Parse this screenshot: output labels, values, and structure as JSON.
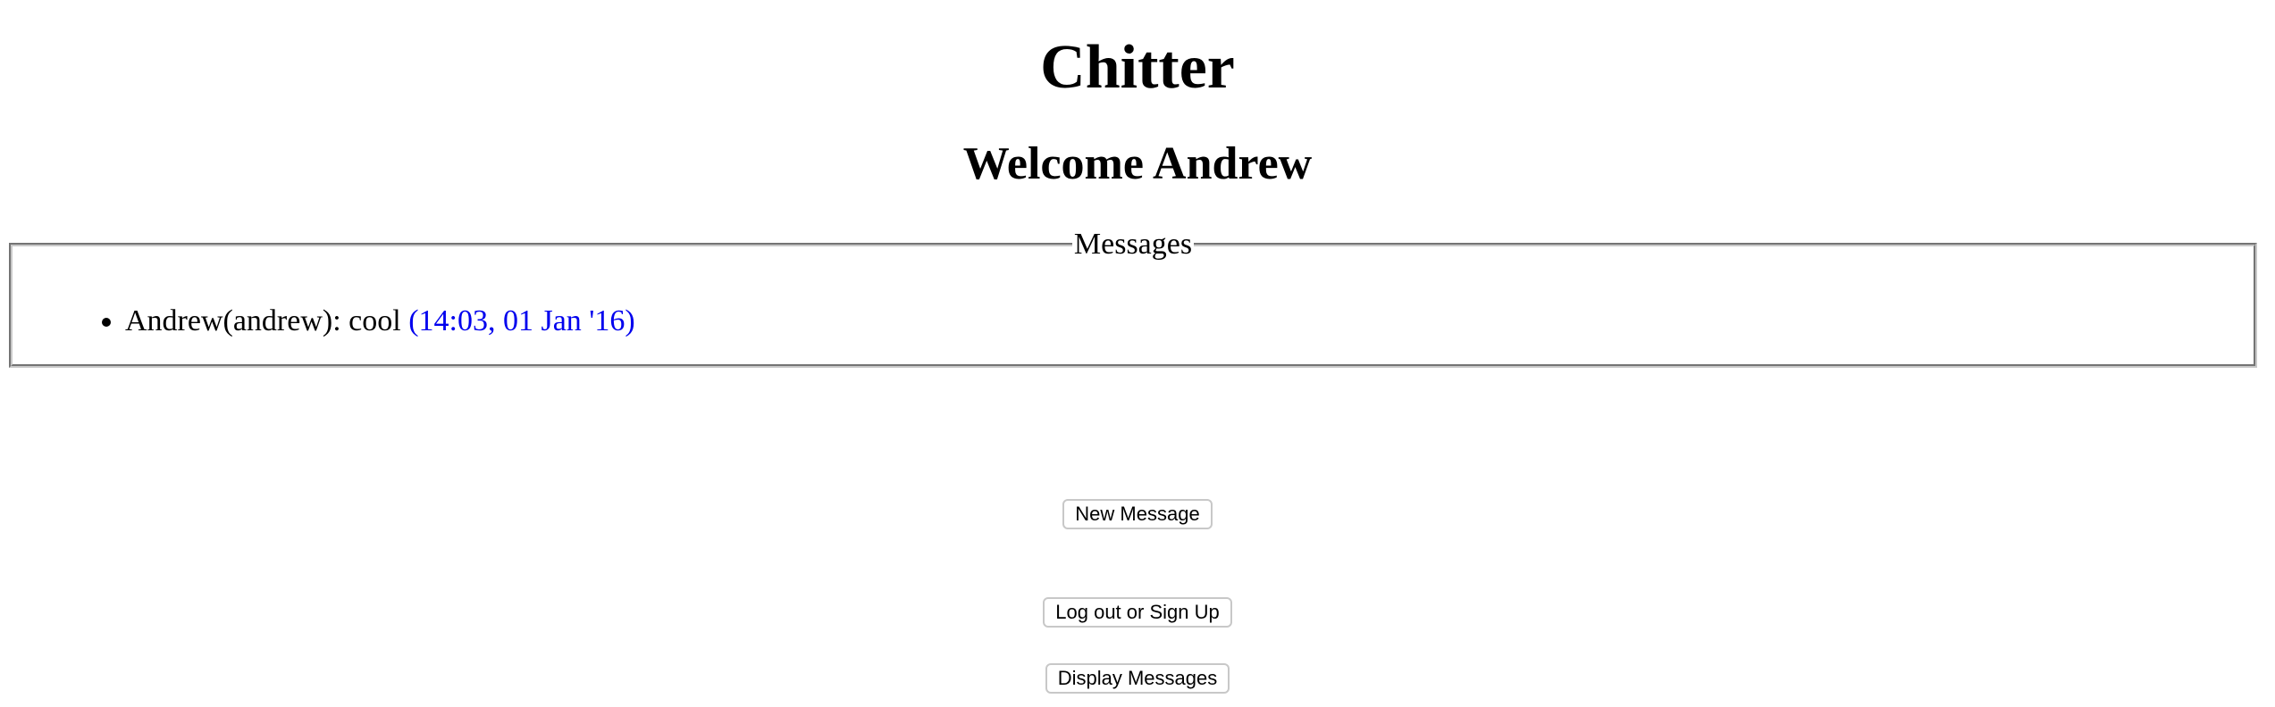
{
  "header": {
    "title": "Chitter",
    "welcome": "Welcome Andrew"
  },
  "messages": {
    "legend": "Messages",
    "items": [
      {
        "text": "Andrew(andrew): cool",
        "time": "(14:03, 01 Jan '16)"
      }
    ]
  },
  "actions": {
    "new_message": "New Message",
    "logout_signup": "Log out or Sign Up",
    "display_messages": "Display Messages"
  },
  "colors": {
    "timestamp": "#0000ee"
  }
}
